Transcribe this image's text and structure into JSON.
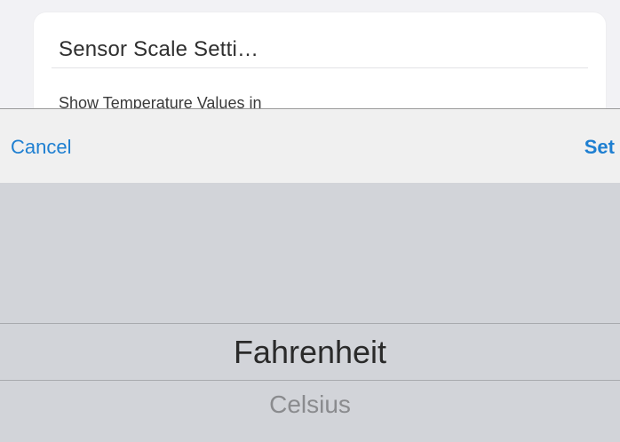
{
  "card": {
    "title": "Sensor Scale Setti…",
    "subtitle": "Show Temperature Values in"
  },
  "sheet": {
    "cancel_label": "Cancel",
    "set_label": "Set"
  },
  "picker": {
    "options": [
      "Fahrenheit",
      "Celsius"
    ],
    "selected": "Fahrenheit"
  },
  "colors": {
    "accent": "#1e7fd1",
    "picker_background": "#d2d4d9",
    "toolbar_background": "#f0f0f0"
  }
}
